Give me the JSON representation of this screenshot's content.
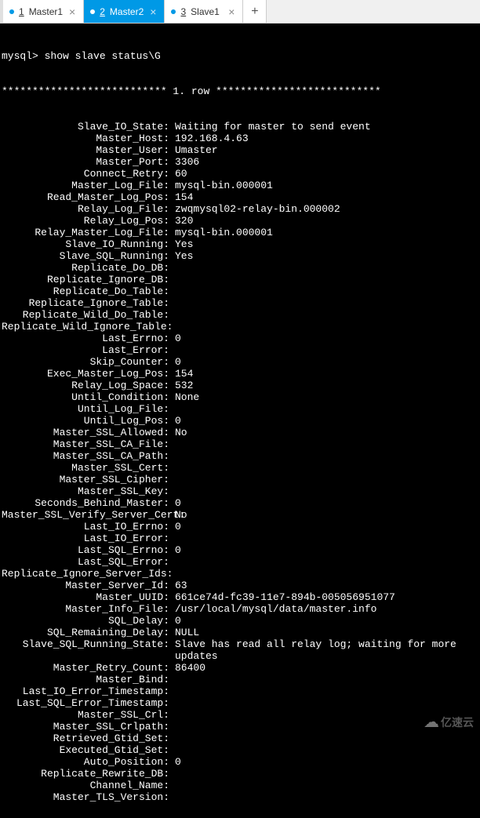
{
  "tabs": [
    {
      "num": "1",
      "label": "Master1",
      "active": false
    },
    {
      "num": "2",
      "label": "Master2",
      "active": true
    },
    {
      "num": "3",
      "label": "Slave1",
      "active": false
    }
  ],
  "prompt": "mysql> show slave status\\G",
  "row_header": "*************************** 1. row ***************************",
  "status": [
    {
      "label": "Slave_IO_State:",
      "value": "Waiting for master to send event"
    },
    {
      "label": "Master_Host:",
      "value": "192.168.4.63"
    },
    {
      "label": "Master_User:",
      "value": "Umaster"
    },
    {
      "label": "Master_Port:",
      "value": "3306"
    },
    {
      "label": "Connect_Retry:",
      "value": "60"
    },
    {
      "label": "Master_Log_File:",
      "value": "mysql-bin.000001"
    },
    {
      "label": "Read_Master_Log_Pos:",
      "value": "154"
    },
    {
      "label": "Relay_Log_File:",
      "value": "zwqmysql02-relay-bin.000002"
    },
    {
      "label": "Relay_Log_Pos:",
      "value": "320"
    },
    {
      "label": "Relay_Master_Log_File:",
      "value": "mysql-bin.000001"
    },
    {
      "label": "Slave_IO_Running:",
      "value": "Yes"
    },
    {
      "label": "Slave_SQL_Running:",
      "value": "Yes"
    },
    {
      "label": "Replicate_Do_DB:",
      "value": ""
    },
    {
      "label": "Replicate_Ignore_DB:",
      "value": ""
    },
    {
      "label": "Replicate_Do_Table:",
      "value": ""
    },
    {
      "label": "Replicate_Ignore_Table:",
      "value": ""
    },
    {
      "label": "Replicate_Wild_Do_Table:",
      "value": ""
    },
    {
      "label": "Replicate_Wild_Ignore_Table:",
      "value": ""
    },
    {
      "label": "Last_Errno:",
      "value": "0"
    },
    {
      "label": "Last_Error:",
      "value": ""
    },
    {
      "label": "Skip_Counter:",
      "value": "0"
    },
    {
      "label": "Exec_Master_Log_Pos:",
      "value": "154"
    },
    {
      "label": "Relay_Log_Space:",
      "value": "532"
    },
    {
      "label": "Until_Condition:",
      "value": "None"
    },
    {
      "label": "Until_Log_File:",
      "value": ""
    },
    {
      "label": "Until_Log_Pos:",
      "value": "0"
    },
    {
      "label": "Master_SSL_Allowed:",
      "value": "No"
    },
    {
      "label": "Master_SSL_CA_File:",
      "value": ""
    },
    {
      "label": "Master_SSL_CA_Path:",
      "value": ""
    },
    {
      "label": "Master_SSL_Cert:",
      "value": ""
    },
    {
      "label": "Master_SSL_Cipher:",
      "value": ""
    },
    {
      "label": "Master_SSL_Key:",
      "value": ""
    },
    {
      "label": "Seconds_Behind_Master:",
      "value": "0"
    },
    {
      "label": "Master_SSL_Verify_Server_Cert:",
      "value": "No"
    },
    {
      "label": "Last_IO_Errno:",
      "value": "0"
    },
    {
      "label": "Last_IO_Error:",
      "value": ""
    },
    {
      "label": "Last_SQL_Errno:",
      "value": "0"
    },
    {
      "label": "Last_SQL_Error:",
      "value": ""
    },
    {
      "label": "Replicate_Ignore_Server_Ids:",
      "value": ""
    },
    {
      "label": "Master_Server_Id:",
      "value": "63"
    },
    {
      "label": "Master_UUID:",
      "value": "661ce74d-fc39-11e7-894b-005056951077"
    },
    {
      "label": "Master_Info_File:",
      "value": "/usr/local/mysql/data/master.info"
    },
    {
      "label": "SQL_Delay:",
      "value": "0"
    },
    {
      "label": "SQL_Remaining_Delay:",
      "value": "NULL"
    },
    {
      "label": "Slave_SQL_Running_State:",
      "value": "Slave has read all relay log; waiting for more updates"
    },
    {
      "label": "Master_Retry_Count:",
      "value": "86400"
    },
    {
      "label": "Master_Bind:",
      "value": ""
    },
    {
      "label": "Last_IO_Error_Timestamp:",
      "value": ""
    },
    {
      "label": "Last_SQL_Error_Timestamp:",
      "value": ""
    },
    {
      "label": "Master_SSL_Crl:",
      "value": ""
    },
    {
      "label": "Master_SSL_Crlpath:",
      "value": ""
    },
    {
      "label": "Retrieved_Gtid_Set:",
      "value": ""
    },
    {
      "label": "Executed_Gtid_Set:",
      "value": ""
    },
    {
      "label": "Auto_Position:",
      "value": "0"
    },
    {
      "label": "Replicate_Rewrite_DB:",
      "value": ""
    },
    {
      "label": "Channel_Name:",
      "value": ""
    },
    {
      "label": "Master_TLS_Version:",
      "value": ""
    }
  ],
  "watermark": "亿速云",
  "add_label": "+"
}
